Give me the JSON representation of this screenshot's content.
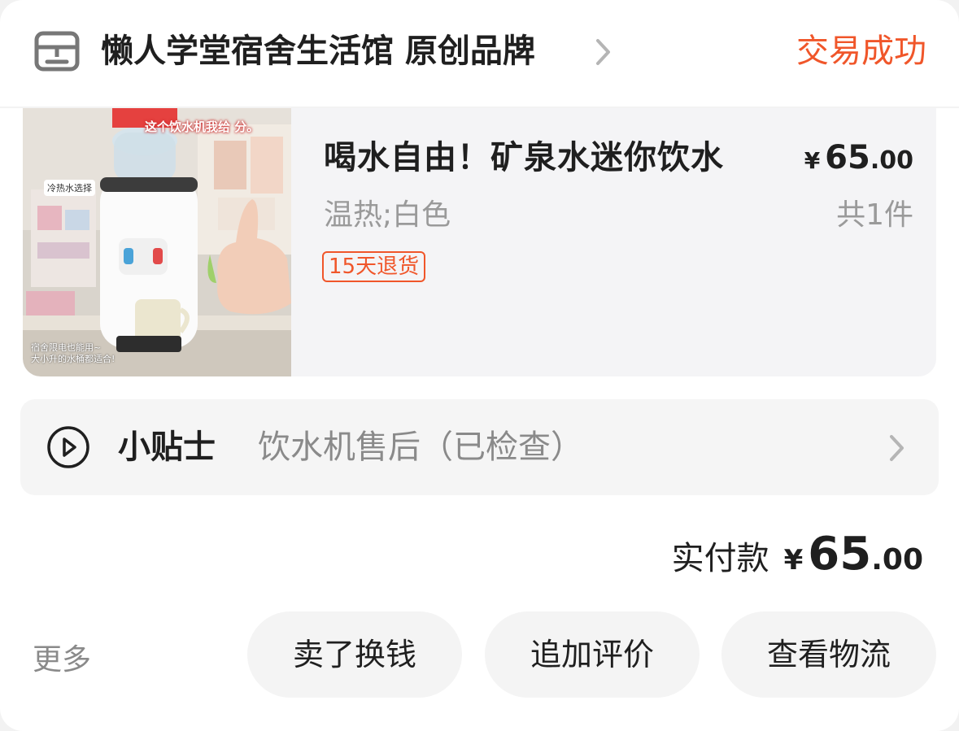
{
  "header": {
    "shop_name": "懒人学堂宿舍生活馆 原创品牌",
    "status": "交易成功",
    "icons": {
      "shop": "store-icon",
      "chevron": "chevron-right-icon"
    }
  },
  "product": {
    "title": "喝水自由！矿泉水迷你饮水",
    "price_symbol": "¥",
    "price_int": "65",
    "price_dec": ".00",
    "sku": "温热;白色",
    "quantity": "共1件",
    "return_tag": "15天退货",
    "image_overlay": {
      "top_caption": "这个饮水机我给 分。",
      "left_label": "冷热水选择",
      "bottom_caption_1": "宿舍限电也能用~",
      "bottom_caption_2": "大小升的水桶都适合!"
    }
  },
  "tips": {
    "icon": "play-circle-icon",
    "title": "小贴士",
    "text": "饮水机售后（已检查）"
  },
  "total": {
    "label": "实付款",
    "symbol": "¥",
    "int": "65",
    "dec": ".00"
  },
  "actions": {
    "more": "更多",
    "sell": "卖了换钱",
    "review": "追加评价",
    "logistics": "查看物流"
  },
  "colors": {
    "accent": "#f0562a",
    "text": "#1f1f1f",
    "muted": "#9a9a9a",
    "panel": "#f4f4f6"
  }
}
